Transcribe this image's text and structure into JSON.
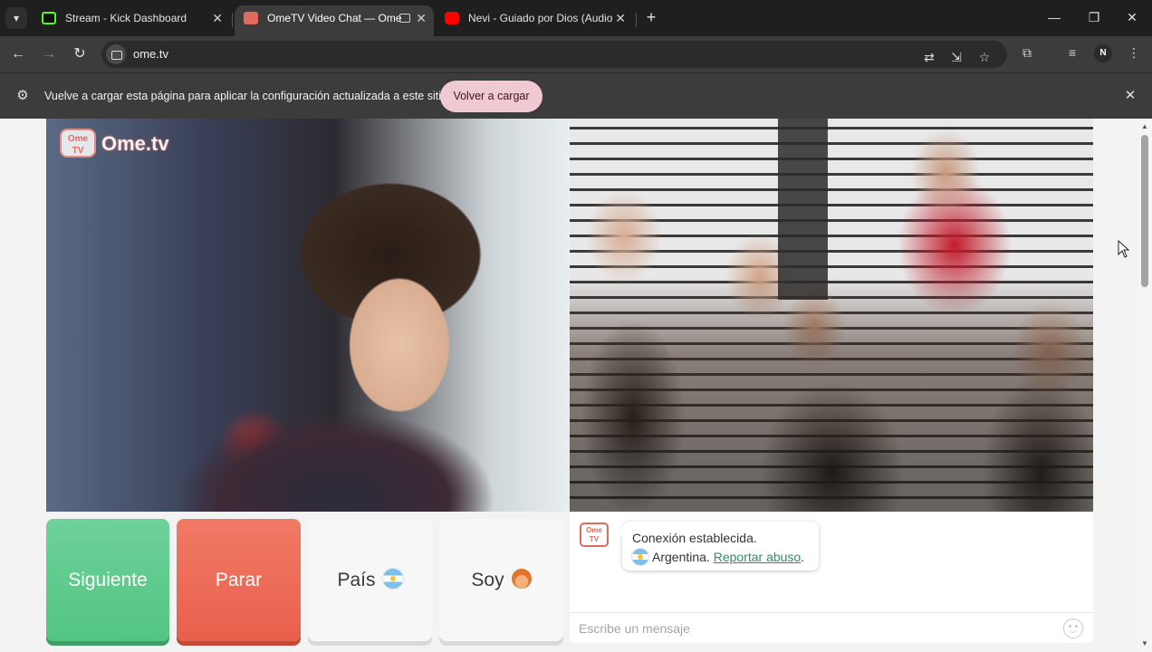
{
  "browser": {
    "tabs": [
      {
        "title": "Stream - Kick Dashboard",
        "favicon_color": "#53fc18",
        "active": false
      },
      {
        "title": "OmeTV Video Chat — Ome",
        "favicon_color": "#e06a5e",
        "active": true
      },
      {
        "title": "Nevi - Guiado por Dios (Audio",
        "favicon_color": "#ff0000",
        "active": false
      }
    ],
    "close_glyph": "✕",
    "url": "ome.tv",
    "profile_initial": "N"
  },
  "infobar": {
    "message": "Vuelve a cargar esta página para aplicar la configuración actualizada a este sitio",
    "button": "Volver a cargar"
  },
  "watermark": {
    "logo_text": "Ome TV",
    "brand": "Ome.tv"
  },
  "controls": {
    "next": "Siguiente",
    "stop": "Parar",
    "country": "País",
    "me": "Soy"
  },
  "chat": {
    "logo_text": "Ome TV",
    "status": "Conexión establecida.",
    "country": "Argentina.",
    "report_link": "Reportar abuso",
    "report_suffix": ".",
    "placeholder": "Escribe un mensaje"
  },
  "colors": {
    "next_button": "#52c481",
    "stop_button": "#e9604c",
    "link": "#2e8f62",
    "reload_button": "#f1c9d3"
  }
}
